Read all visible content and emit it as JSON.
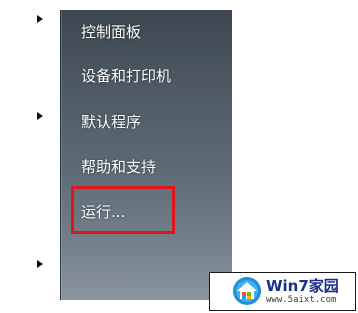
{
  "start_menu": {
    "items": [
      {
        "label": "控制面板"
      },
      {
        "label": "设备和打印机"
      },
      {
        "label": "默认程序"
      },
      {
        "label": "帮助和支持"
      },
      {
        "label": "运行..."
      }
    ],
    "highlighted_item": "运行..."
  },
  "watermark": {
    "title": "Win7家园",
    "url": "www.5aixt.com"
  },
  "colors": {
    "highlight_border": "#e0141b",
    "panel_top": "#3c4752",
    "panel_bottom": "#8a95a0"
  }
}
